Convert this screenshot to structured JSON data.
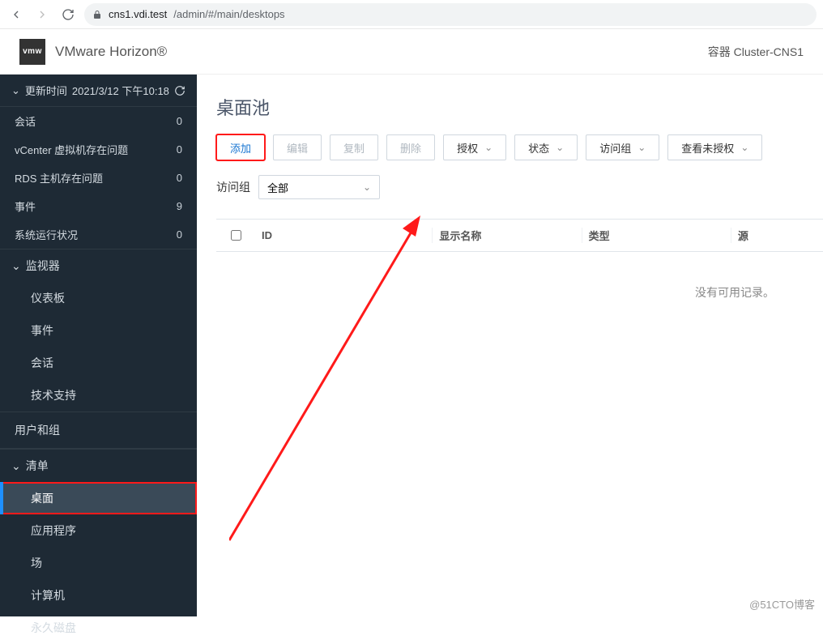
{
  "browser": {
    "url_host": "cns1.vdi.test",
    "url_path": "/admin/#/main/desktops"
  },
  "header": {
    "logo_text": "vmw",
    "product": "VMware Horizon®",
    "cluster_label": "容器 Cluster-CNS1"
  },
  "sidebar": {
    "update_prefix": "更新时间",
    "update_time": "2021/3/12 下午10:18",
    "stats": [
      {
        "label": "会话",
        "value": "0"
      },
      {
        "label": "vCenter 虚拟机存在问题",
        "value": "0"
      },
      {
        "label": "RDS 主机存在问题",
        "value": "0"
      },
      {
        "label": "事件",
        "value": "9"
      },
      {
        "label": "系统运行状况",
        "value": "0"
      }
    ],
    "monitor_label": "监视器",
    "monitor_items": [
      "仪表板",
      "事件",
      "会话",
      "技术支持"
    ],
    "users_groups": "用户和组",
    "inventory_label": "清单",
    "inventory_items": [
      "桌面",
      "应用程序",
      "场",
      "计算机",
      "永久磁盘"
    ]
  },
  "main": {
    "title": "桌面池",
    "buttons": {
      "add": "添加",
      "edit": "编辑",
      "copy": "复制",
      "delete": "删除",
      "entitle": "授权",
      "status": "状态",
      "access_group": "访问组",
      "view_unentitled": "查看未授权"
    },
    "filter": {
      "label": "访问组",
      "value": "全部"
    },
    "table": {
      "cols": {
        "id": "ID",
        "display_name": "显示名称",
        "type": "类型",
        "source": "源"
      },
      "empty": "没有可用记录。"
    }
  },
  "watermark": "@51CTO博客"
}
